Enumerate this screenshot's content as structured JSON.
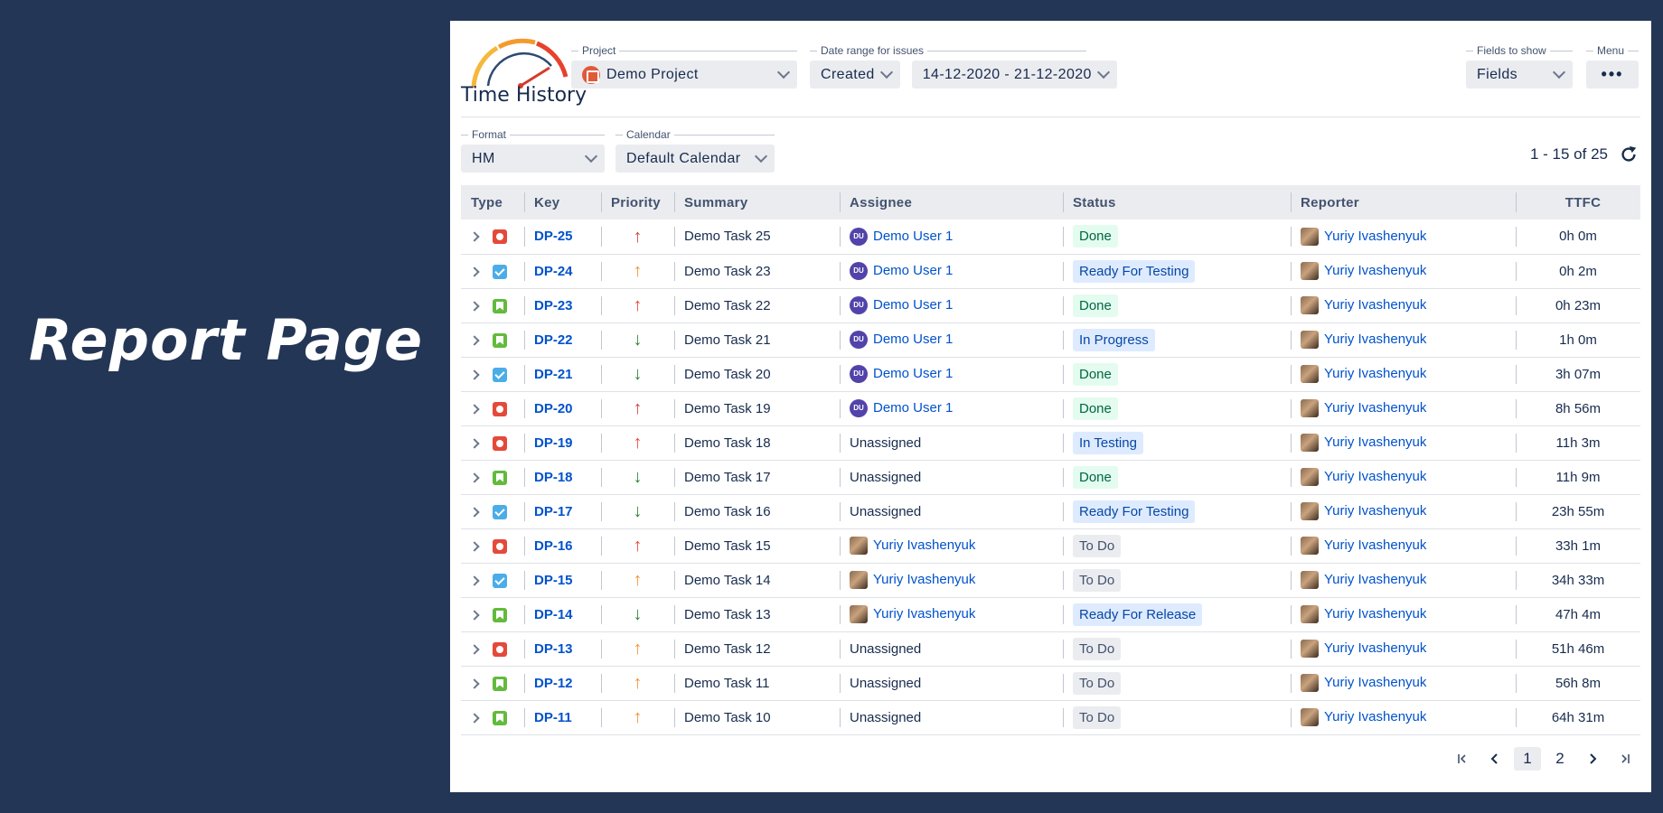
{
  "hero": {
    "title": "Report Page"
  },
  "app": {
    "name": "Time History"
  },
  "filters": {
    "project": {
      "label": "Project",
      "value": "Demo Project"
    },
    "date_range": {
      "label": "Date range for issues",
      "type_value": "Created",
      "range_value": "14-12-2020 - 21-12-2020"
    },
    "fields": {
      "label": "Fields to show",
      "value": "Fields"
    },
    "menu": {
      "label": "Menu",
      "value": "•••"
    },
    "format": {
      "label": "Format",
      "value": "HM"
    },
    "calendar": {
      "label": "Calendar",
      "value": "Default Calendar"
    }
  },
  "pagination": {
    "summary": "1 - 15 of 25",
    "pages": [
      "1",
      "2"
    ],
    "current": "1"
  },
  "table": {
    "columns": [
      "Type",
      "Key",
      "Priority",
      "Summary",
      "Assignee",
      "Status",
      "Reporter",
      "TTFC"
    ],
    "rows": [
      {
        "type": "bug",
        "key": "DP-25",
        "priority": "highest",
        "summary": "Demo Task 25",
        "assignee": "Demo User 1",
        "assignee_avatar": "DU",
        "status": "Done",
        "reporter": "Yuriy Ivashenyuk",
        "ttfc": "0h 0m"
      },
      {
        "type": "task",
        "key": "DP-24",
        "priority": "medium",
        "summary": "Demo Task 23",
        "assignee": "Demo User 1",
        "assignee_avatar": "DU",
        "status": "Ready For Testing",
        "reporter": "Yuriy Ivashenyuk",
        "ttfc": "0h 2m"
      },
      {
        "type": "story",
        "key": "DP-23",
        "priority": "high",
        "summary": "Demo Task 22",
        "assignee": "Demo User 1",
        "assignee_avatar": "DU",
        "status": "Done",
        "reporter": "Yuriy Ivashenyuk",
        "ttfc": "0h 23m"
      },
      {
        "type": "story",
        "key": "DP-22",
        "priority": "lowest",
        "summary": "Demo Task 21",
        "assignee": "Demo User 1",
        "assignee_avatar": "DU",
        "status": "In Progress",
        "reporter": "Yuriy Ivashenyuk",
        "ttfc": "1h 0m"
      },
      {
        "type": "task",
        "key": "DP-21",
        "priority": "low",
        "summary": "Demo Task 20",
        "assignee": "Demo User 1",
        "assignee_avatar": "DU",
        "status": "Done",
        "reporter": "Yuriy Ivashenyuk",
        "ttfc": "3h 07m"
      },
      {
        "type": "bug",
        "key": "DP-20",
        "priority": "highest",
        "summary": "Demo Task 19",
        "assignee": "Demo User 1",
        "assignee_avatar": "DU",
        "status": "Done",
        "reporter": "Yuriy Ivashenyuk",
        "ttfc": "8h 56m"
      },
      {
        "type": "bug",
        "key": "DP-19",
        "priority": "high",
        "summary": "Demo Task 18",
        "assignee": "Unassigned",
        "assignee_avatar": "",
        "status": "In Testing",
        "reporter": "Yuriy Ivashenyuk",
        "ttfc": "11h 3m"
      },
      {
        "type": "story",
        "key": "DP-18",
        "priority": "low",
        "summary": "Demo Task 17",
        "assignee": "Unassigned",
        "assignee_avatar": "",
        "status": "Done",
        "reporter": "Yuriy Ivashenyuk",
        "ttfc": "11h 9m"
      },
      {
        "type": "task",
        "key": "DP-17",
        "priority": "lowest",
        "summary": "Demo Task 16",
        "assignee": "Unassigned",
        "assignee_avatar": "",
        "status": "Ready For Testing",
        "reporter": "Yuriy Ivashenyuk",
        "ttfc": "23h 55m"
      },
      {
        "type": "bug",
        "key": "DP-16",
        "priority": "high",
        "summary": "Demo Task 15",
        "assignee": "Yuriy Ivashenyuk",
        "assignee_avatar": "photo",
        "status": "To Do",
        "reporter": "Yuriy Ivashenyuk",
        "ttfc": "33h 1m"
      },
      {
        "type": "task",
        "key": "DP-15",
        "priority": "medium",
        "summary": "Demo Task 14",
        "assignee": "Yuriy Ivashenyuk",
        "assignee_avatar": "photo",
        "status": "To Do",
        "reporter": "Yuriy Ivashenyuk",
        "ttfc": "34h 33m"
      },
      {
        "type": "story",
        "key": "DP-14",
        "priority": "lowest",
        "summary": "Demo Task 13",
        "assignee": "Yuriy Ivashenyuk",
        "assignee_avatar": "photo",
        "status": "Ready For Release",
        "reporter": "Yuriy Ivashenyuk",
        "ttfc": "47h 4m"
      },
      {
        "type": "bug",
        "key": "DP-13",
        "priority": "medium",
        "summary": "Demo Task 12",
        "assignee": "Unassigned",
        "assignee_avatar": "",
        "status": "To Do",
        "reporter": "Yuriy Ivashenyuk",
        "ttfc": "51h 46m"
      },
      {
        "type": "story",
        "key": "DP-12",
        "priority": "medium",
        "summary": "Demo Task 11",
        "assignee": "Unassigned",
        "assignee_avatar": "",
        "status": "To Do",
        "reporter": "Yuriy Ivashenyuk",
        "ttfc": "56h 8m"
      },
      {
        "type": "story",
        "key": "DP-11",
        "priority": "medium",
        "summary": "Demo Task 10",
        "assignee": "Unassigned",
        "assignee_avatar": "",
        "status": "To Do",
        "reporter": "Yuriy Ivashenyuk",
        "ttfc": "64h 31m"
      }
    ]
  },
  "colors": {
    "background": "#233656",
    "link": "#0052cc",
    "priority_highest": "#d04437",
    "priority_high": "#e5493a",
    "priority_medium": "#f79232",
    "priority_low": "#2a8735",
    "priority_lowest": "#2a8735"
  }
}
